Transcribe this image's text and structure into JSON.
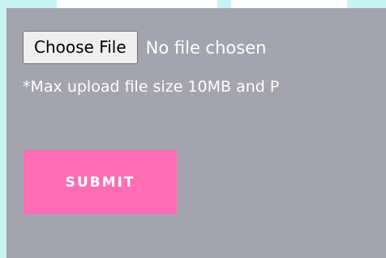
{
  "file_input": {
    "button_label": "Choose File",
    "status_text": "No file chosen"
  },
  "upload_hint": "*Max upload file size 10MB and P",
  "submit_label": "SUBMIT",
  "colors": {
    "page_background": "#c8f4f4",
    "panel_background": "#a3a4ae",
    "submit_background": "#ff6eb4"
  }
}
